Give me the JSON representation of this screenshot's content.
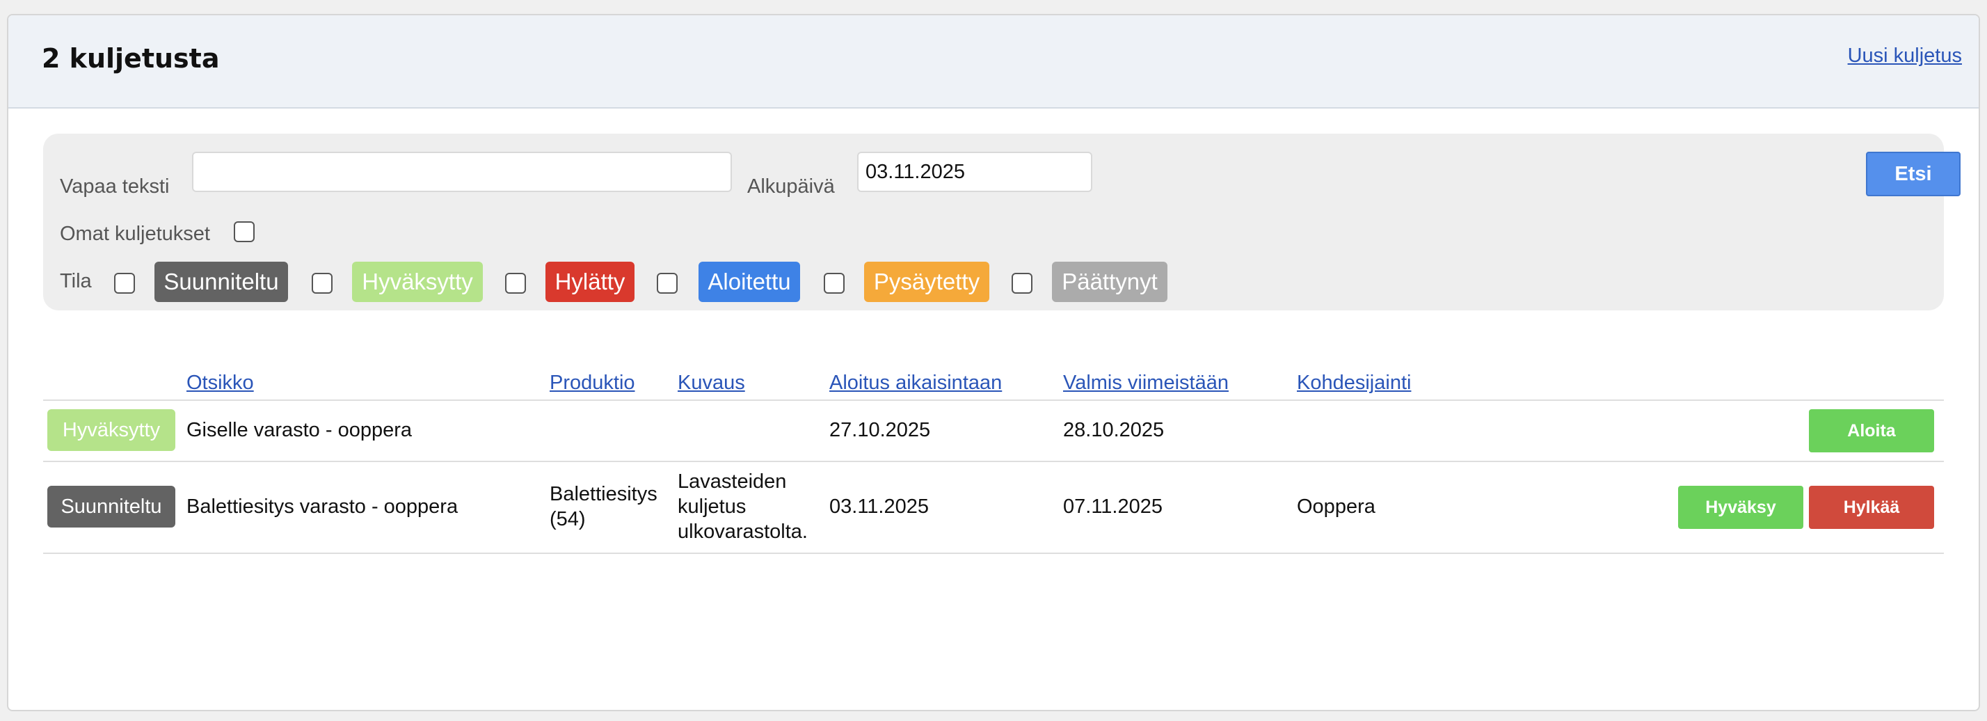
{
  "header": {
    "title": "2 kuljetusta",
    "new_link": "Uusi kuljetus"
  },
  "filters": {
    "free_text_label": "Vapaa teksti",
    "free_text_value": "",
    "start_date_label": "Alkupäivä",
    "start_date_value": "03.11.2025",
    "own_label": "Omat kuljetukset",
    "status_label": "Tila",
    "statuses": [
      {
        "label": "Suunniteltu",
        "color": "#636363"
      },
      {
        "label": "Hyväksytty",
        "color": "#b5e38a"
      },
      {
        "label": "Hylätty",
        "color": "#d9392d"
      },
      {
        "label": "Aloitettu",
        "color": "#3e82e6"
      },
      {
        "label": "Pysäytetty",
        "color": "#f5a93a"
      },
      {
        "label": "Päättynyt",
        "color": "#ababab"
      }
    ],
    "search_button": "Etsi"
  },
  "table": {
    "headers": [
      "Otsikko",
      "Produktio",
      "Kuvaus",
      "Aloitus aikaisintaan",
      "Valmis viimeistään",
      "Kohdesijainti"
    ],
    "rows": [
      {
        "status": "Hyväksytty",
        "status_color": "#b5e38a",
        "title": "Giselle varasto - ooppera",
        "production": [
          "",
          ""
        ],
        "description": [
          "",
          "",
          ""
        ],
        "start": "27.10.2025",
        "end": "28.10.2025",
        "location": "",
        "actions": [
          {
            "label": "Aloita",
            "color": "#6bd15b"
          }
        ]
      },
      {
        "status": "Suunniteltu",
        "status_color": "#636363",
        "title": "Balettiesitys varasto - ooppera",
        "production": [
          "Balettiesitys",
          "(54)"
        ],
        "description": [
          "Lavasteiden",
          "kuljetus",
          "ulkovarastolta."
        ],
        "start": "03.11.2025",
        "end": "07.11.2025",
        "location": "Ooppera",
        "actions": [
          {
            "label": "Hyväksy",
            "color": "#6bd15b"
          },
          {
            "label": "Hylkää",
            "color": "#d04a3c"
          }
        ]
      }
    ]
  }
}
